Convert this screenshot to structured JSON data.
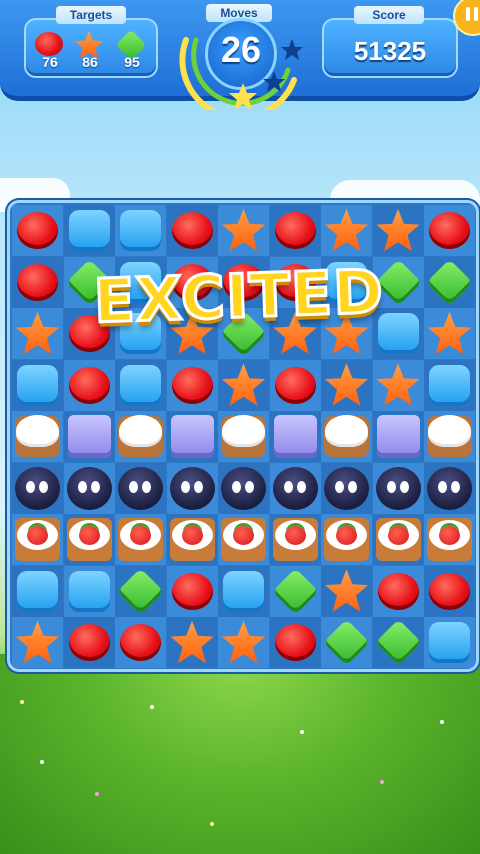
{
  "hud": {
    "targets": {
      "label": "Targets",
      "items": [
        {
          "icon": "red-candy-icon",
          "count": "76"
        },
        {
          "icon": "orange-star-candy-icon",
          "count": "86"
        },
        {
          "icon": "green-candy-icon",
          "count": "95"
        }
      ]
    },
    "moves": {
      "label": "Moves",
      "value": "26"
    },
    "score": {
      "label": "Score",
      "value": "51325"
    }
  },
  "banner": {
    "text": "EXCITED"
  },
  "colors": {
    "hud_blue": "#2d86e6",
    "board_blue": "#2d79c6",
    "banner_yellow": "#ffd51f"
  },
  "board": {
    "rows": 9,
    "cols": 9,
    "grid": [
      [
        "red",
        "blue",
        "blue",
        "red",
        "orange",
        "red",
        "orange",
        "orange",
        "red"
      ],
      [
        "red",
        "green",
        "blue",
        "red",
        "red",
        "red",
        "blue",
        "green",
        "green"
      ],
      [
        "orange",
        "red",
        "blue",
        "orange",
        "green",
        "orange",
        "orange",
        "blue",
        "orange"
      ],
      [
        "blue",
        "red",
        "blue",
        "red",
        "orange",
        "red",
        "orange",
        "orange",
        "blue"
      ],
      [
        "cream",
        "ice",
        "cream",
        "ice",
        "cream",
        "ice",
        "cream",
        "ice",
        "cream"
      ],
      [
        "blob",
        "blob",
        "blob",
        "blob",
        "blob",
        "blob",
        "blob",
        "blob",
        "blob"
      ],
      [
        "tomato",
        "tomato",
        "tomato",
        "tomato",
        "tomato",
        "tomato",
        "tomato",
        "tomato",
        "tomato"
      ],
      [
        "blue",
        "blue",
        "green",
        "red",
        "blue",
        "green",
        "orange",
        "red",
        "red"
      ],
      [
        "orange",
        "red",
        "red",
        "orange",
        "orange",
        "red",
        "green",
        "green",
        "blue"
      ]
    ]
  }
}
